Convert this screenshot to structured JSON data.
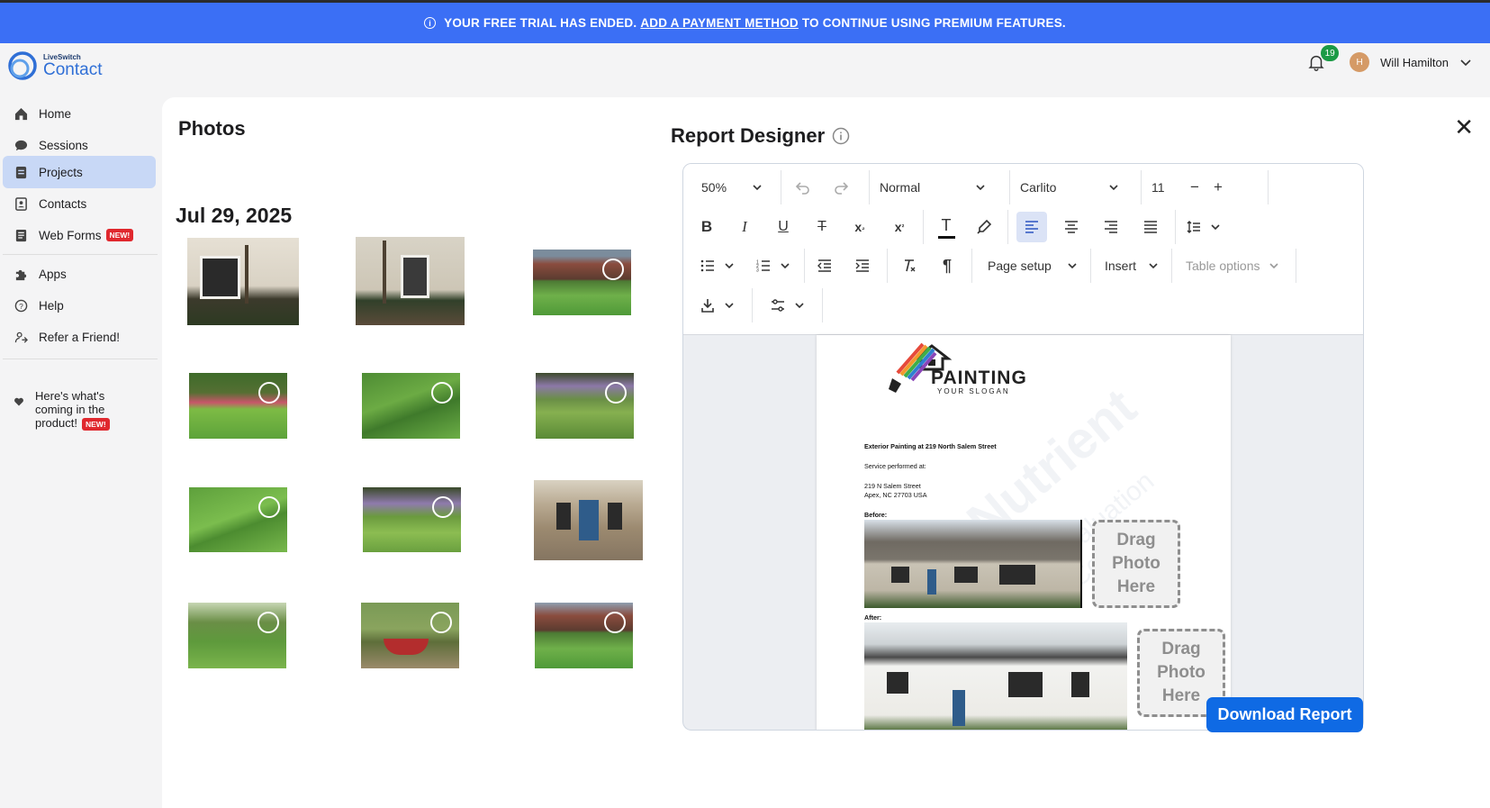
{
  "banner": {
    "prefix": "YOUR FREE TRIAL HAS ENDED.",
    "link": "ADD A PAYMENT METHOD",
    "suffix": "TO CONTINUE USING PREMIUM FEATURES."
  },
  "logo": {
    "small": "LiveSwitch",
    "big": "Contact"
  },
  "sidebar": {
    "items": [
      {
        "label": "Home",
        "icon": "home-icon"
      },
      {
        "label": "Sessions",
        "icon": "chat-icon"
      },
      {
        "label": "Projects",
        "icon": "clipboard-icon",
        "active": true
      },
      {
        "label": "Contacts",
        "icon": "address-book-icon"
      },
      {
        "label": "Web Forms",
        "icon": "form-icon",
        "badge": "NEW!"
      },
      {
        "label": "Apps",
        "icon": "puzzle-icon"
      },
      {
        "label": "Help",
        "icon": "help-icon"
      },
      {
        "label": "Refer a Friend!",
        "icon": "refer-icon"
      }
    ],
    "whats_new": {
      "line1": "Here's what's",
      "line2": "coming in the",
      "line3": "product!",
      "badge": "NEW!"
    }
  },
  "header": {
    "notifications": "19",
    "avatar_initial": "H",
    "user_name": "Will Hamilton"
  },
  "photos": {
    "title": "Photos",
    "date": "Jul 29, 2025"
  },
  "designer": {
    "title": "Report Designer",
    "zoom": "50%",
    "style": "Normal",
    "font": "Carlito",
    "font_size": "11",
    "page_setup": "Page setup",
    "insert": "Insert",
    "table_options": "Table options"
  },
  "document": {
    "logo_word": "PAINTING",
    "logo_slogan": "YOUR SLOGAN",
    "heading": "Exterior Painting at 219 North Salem Street",
    "service_label": "Service performed at:",
    "address1": "219 N Salem Street",
    "address2": "Apex, NC 27703 USA",
    "before_label": "Before:",
    "after_label": "After:",
    "drag_text": "Drag Photo Here",
    "watermark": "Nutrient",
    "watermark_sub": "Evaluation Copy"
  },
  "download_button": "Download Report",
  "colors": {
    "banner": "#3b6ff5",
    "primary": "#0f6ae4",
    "active_nav": "#c8d8f6"
  }
}
